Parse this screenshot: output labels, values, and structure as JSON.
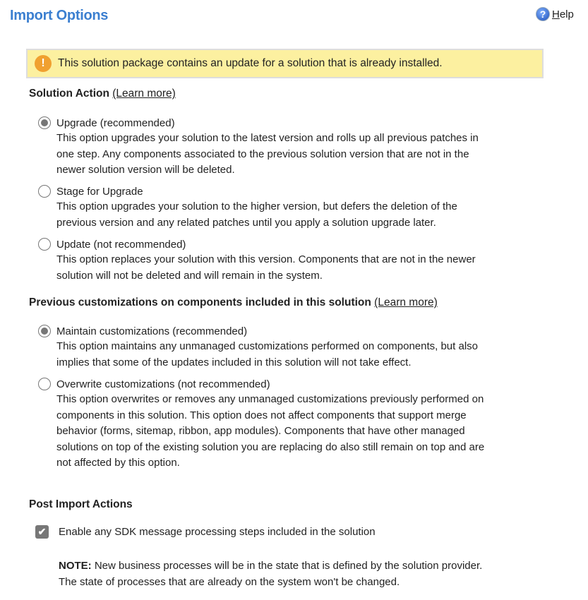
{
  "header": {
    "title": "Import Options",
    "help_label": "Help",
    "help_icon": "help-circle-icon"
  },
  "banner": {
    "icon": "warning-icon",
    "text": "This solution package contains an update for a solution that is already installed.",
    "bg_color": "#fcf0a0"
  },
  "solution_action": {
    "heading": "Solution Action",
    "learn_more": "(Learn more)",
    "options": [
      {
        "label": "Upgrade (recommended)",
        "selected": true,
        "lines": [
          "This option upgrades your solution to the latest version and rolls up all previous patches in",
          "one step. Any components associated to the previous solution version that are not in the",
          "newer solution version will be deleted."
        ]
      },
      {
        "label": "Stage for Upgrade",
        "selected": false,
        "lines": [
          "This option upgrades your solution to the higher version, but defers the deletion of the",
          "previous version and any related patches until you apply a solution upgrade later."
        ]
      },
      {
        "label": "Update (not recommended)",
        "selected": false,
        "lines": [
          "This option replaces your solution with this version. Components that are not in the newer",
          "solution will not be deleted and will remain in the system."
        ]
      }
    ]
  },
  "customizations": {
    "heading": "Previous customizations on components included in this solution",
    "learn_more": "(Learn more)",
    "options": [
      {
        "label": "Maintain customizations (recommended)",
        "selected": true,
        "lines": [
          "This option maintains any unmanaged customizations performed on components, but also",
          "implies that some of the updates included in this solution will not take effect."
        ]
      },
      {
        "label": "Overwrite customizations (not recommended)",
        "selected": false,
        "lines": [
          "This option overwrites or removes any unmanaged customizations previously performed on",
          "components in this solution. This option does not affect components that support merge",
          "behavior (forms, sitemap, ribbon, app modules). Components that have other managed",
          "solutions on top of the existing solution you are replacing do also still remain on top and are",
          "not affected by this option."
        ]
      }
    ]
  },
  "post_import": {
    "heading": "Post Import Actions",
    "checkbox_label": "Enable any SDK message processing steps included in the solution",
    "checked": true,
    "note_label": "NOTE:",
    "note_lines": [
      " New business processes will be in the state that is defined by the solution provider.",
      "The state of processes that are already on the system won't be changed."
    ]
  }
}
